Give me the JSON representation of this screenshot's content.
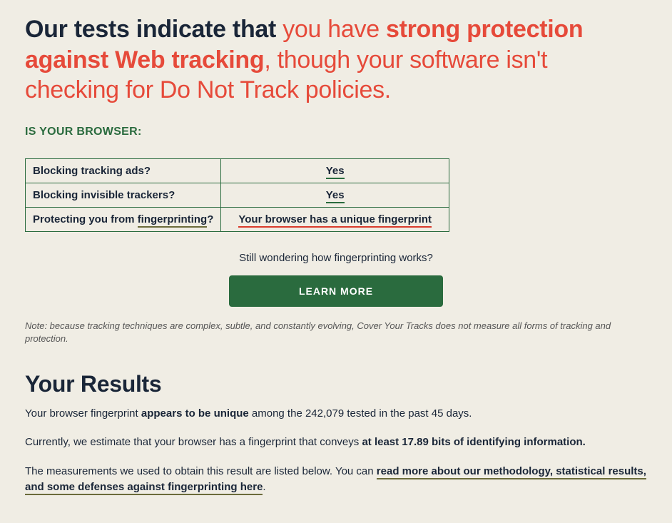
{
  "headline": {
    "lead": "Our tests indicate that ",
    "mid": "you have ",
    "strong": "strong protection against Web tracking",
    "tail": ", though your software isn't checking for Do Not Track policies."
  },
  "subhead": "IS YOUR BROWSER:",
  "table": {
    "rows": [
      {
        "q_pre": "Blocking tracking ads?",
        "q_link": "",
        "q_post": "",
        "a": "Yes",
        "a_class": "ul-green"
      },
      {
        "q_pre": "Blocking invisible trackers?",
        "q_link": "",
        "q_post": "",
        "a": "Yes",
        "a_class": "ul-green"
      },
      {
        "q_pre": "Protecting you from ",
        "q_link": "fingerprinting",
        "q_post": "?",
        "a": "Your browser has a unique fingerprint",
        "a_class": "ul-red"
      }
    ]
  },
  "wonder": "Still wondering how fingerprinting works?",
  "learn_btn": "LEARN MORE",
  "note": "Note: because tracking techniques are complex, subtle, and constantly evolving, Cover Your Tracks does not measure all forms of tracking and protection.",
  "results_h": "Your Results",
  "p1": {
    "a": "Your browser fingerprint ",
    "b": "appears to be unique",
    "c": " among the 242,079 tested in the past 45 days."
  },
  "p2": {
    "a": "Currently, we estimate that your browser has a fingerprint that conveys ",
    "b": "at least 17.89 bits of identifying information."
  },
  "p3": {
    "a": "The measurements we used to obtain this result are listed below. You can ",
    "link": "read more about our methodology, statistical results, and some defenses against fingerprinting here",
    "c": "."
  }
}
